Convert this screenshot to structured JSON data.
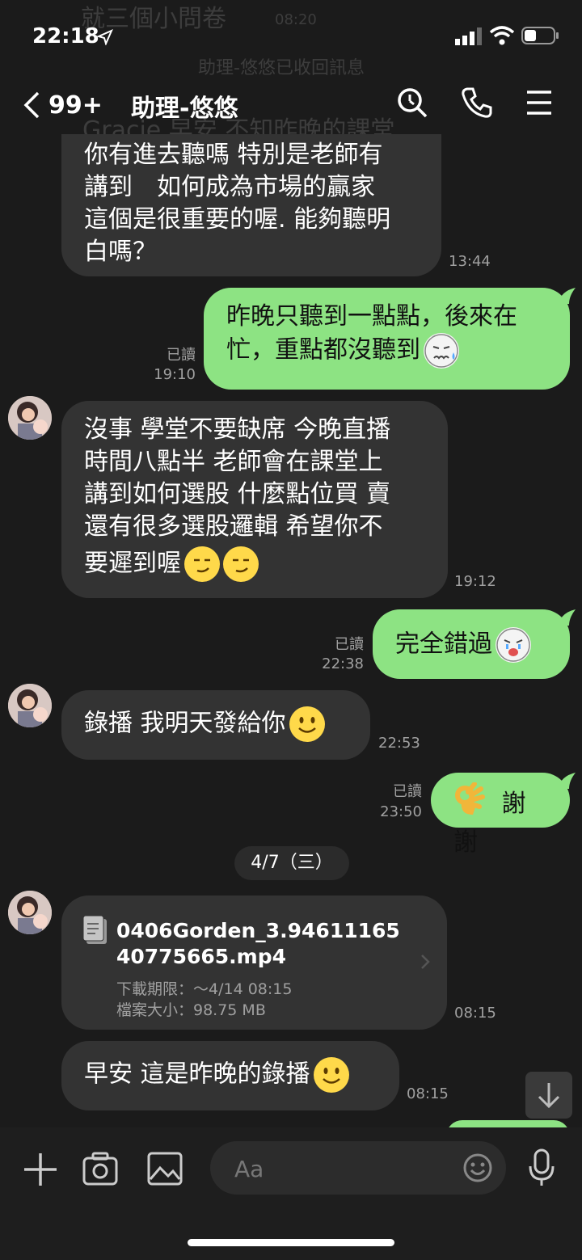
{
  "status": {
    "time": "22:18"
  },
  "ghost_top": {
    "text": "就三個小問卷",
    "time": "08:20",
    "recall": "助理-悠悠已收回訊息",
    "line": "Gracie 早安 不知昨晚的課堂"
  },
  "nav": {
    "back_count": "99+",
    "title": "助理-悠悠"
  },
  "messages": {
    "m1": {
      "lines": [
        "你有進去聽嗎 特別是老師有",
        "講到　如何成為市場的贏家",
        "這個是很重要的喔. 能夠聽明",
        "白嗎？"
      ],
      "time": "13:44"
    },
    "m2": {
      "lines": [
        "昨晚只聽到一點點，後來在",
        "忙，重點都沒聽到"
      ],
      "read": "已讀",
      "time": "19:10"
    },
    "m3": {
      "lines": [
        "沒事 學堂不要缺席 今晚直播",
        "時間八點半 老師會在課堂上",
        "講到如何選股 什麼點位買 賣",
        "還有很多選股邏輯 希望你不",
        "要遲到喔"
      ],
      "time": "19:12"
    },
    "m4": {
      "text": "完全錯過",
      "read": "已讀",
      "time": "22:38"
    },
    "m5": {
      "text": "錄播 我明天發給你",
      "time": "22:53"
    },
    "m6": {
      "text": "謝謝",
      "read": "已讀",
      "time": "23:50"
    },
    "date_sep": "4/7（三）",
    "m7": {
      "name_l1": "0406Gorden_3.94611165",
      "name_l2": "40775665.mp4",
      "deadline": "下載期限：～4/14 08:15",
      "size": "檔案大小：98.75 MB",
      "time": "08:15"
    },
    "m8": {
      "text": "早安 這是昨晚的錄播",
      "time": "08:15"
    }
  },
  "composer": {
    "placeholder": "Aa"
  },
  "colors": {
    "incoming": "#333333",
    "outgoing": "#8de383",
    "background": "#1b1b1b"
  }
}
